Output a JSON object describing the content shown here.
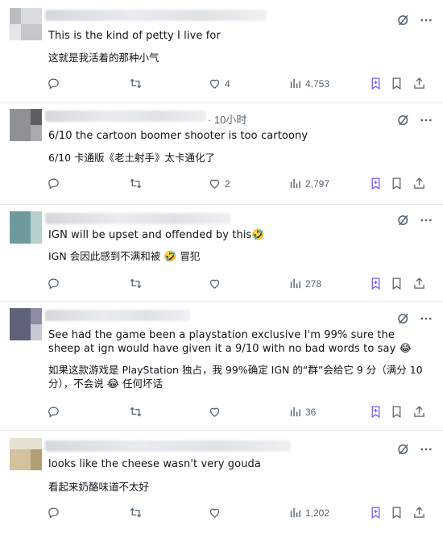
{
  "posts": [
    {
      "time": "",
      "text_en": "This is the kind of petty I live for",
      "text_zh": "这就是我活着的那种小气",
      "likes": "4",
      "views": "4,753",
      "retweets": "",
      "replies": ""
    },
    {
      "time": "· 10小时",
      "text_en": "6/10 the cartoon boomer shooter is too cartoony",
      "text_zh": "6/10 卡通版《老土射手》太卡通化了",
      "likes": "2",
      "views": "2,797",
      "retweets": "",
      "replies": ""
    },
    {
      "time": "",
      "text_en": "IGN  will be upset and offended by this",
      "text_en_emoji": "🤣",
      "text_zh": "IGN 会因此感到不满和被",
      "text_zh_emoji": "🤣",
      "text_zh_tail": "冒犯",
      "likes": "",
      "views": "278",
      "retweets": "",
      "replies": ""
    },
    {
      "time": "",
      "text_en": "See had the game been a playstation exclusive I'm 99% sure the sheep at ign would have given it a 9/10 with no bad words to say",
      "text_en_emoji": "😂",
      "text_zh": "如果这款游戏是 PlayStation 独占，我 99%确定 IGN 的“群”会给它 9 分（满分 10 分），不会说",
      "text_zh_emoji": "😂",
      "text_zh_tail": "任何坏话",
      "likes": "",
      "views": "36",
      "retweets": "",
      "replies": ""
    },
    {
      "time": "",
      "text_en": "looks like the cheese wasn't very gouda",
      "text_zh": "看起来奶酪味道不太好",
      "likes": "",
      "views": "1,202",
      "retweets": "",
      "replies": ""
    }
  ],
  "icons": {
    "grok": "grok-icon",
    "more": "more-icon",
    "reply": "reply-icon",
    "retweet": "retweet-icon",
    "like": "heart-icon",
    "views": "views-icon",
    "bookmark_plus": "bookmark-plus-icon",
    "bookmark": "bookmark-icon",
    "share": "share-icon"
  },
  "colors": {
    "text": "#0f1419",
    "muted": "#536471",
    "accent": "#7856ff",
    "divider": "#e6e9ec"
  }
}
